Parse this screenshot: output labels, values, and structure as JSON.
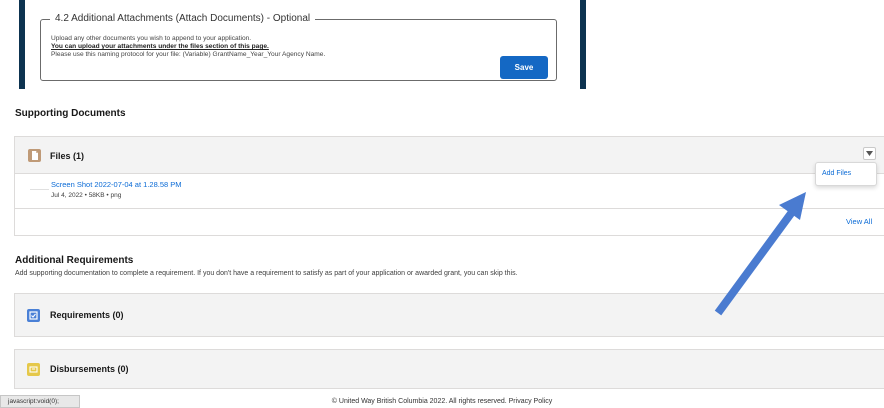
{
  "attachments": {
    "legend": "4.2 Additional Attachments (Attach Documents) - Optional",
    "line1": "Upload any other documents you wish to append to your application.",
    "line2": "You can upload your attachments under the files section of this page.",
    "line3": "Please use this naming protocol for your file: (Variable) GrantName_Year_Your Agency Name.",
    "save_label": "Save"
  },
  "supporting_documents": {
    "heading": "Supporting Documents",
    "files_title": "Files (1)",
    "file": {
      "name": "Screen Shot 2022-07-04 at 1.28.58 PM",
      "meta": "Jul 4, 2022 • 58KB • png"
    },
    "view_all": "View All",
    "menu_add_files": "Add Files"
  },
  "additional_requirements": {
    "heading": "Additional Requirements",
    "description": "Add supporting documentation to complete a requirement. If you don't have a requirement to satisfy as part of your application or awarded grant, you can skip this.",
    "requirements_title": "Requirements (0)",
    "disbursements_title": "Disbursements (0)"
  },
  "footer": {
    "status_url": "javascript:void(0);",
    "copyright": "© United Way British Columbia 2022. All rights reserved. Privacy Policy"
  },
  "colors": {
    "accent_blue": "#1468c4",
    "link_blue": "#0b6bd6",
    "annotation_arrow": "#4a7bd0",
    "panel_border": "#0d3350"
  }
}
